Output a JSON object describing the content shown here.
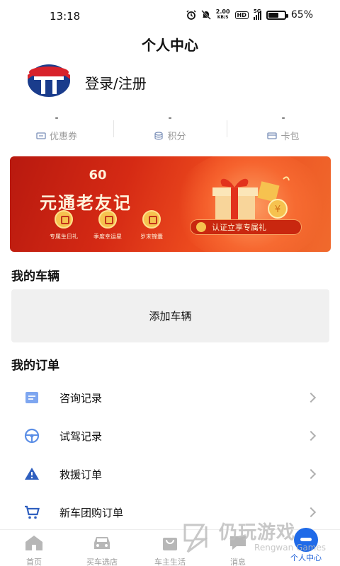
{
  "status_bar": {
    "time": "13:18",
    "net_speed_value": "2.00",
    "net_speed_unit": "KB/S",
    "hd": "HD",
    "signal_type": "5G",
    "battery_percent": "65%",
    "battery_level": 0.65
  },
  "header": {
    "title": "个人中心"
  },
  "profile": {
    "login_label": "登录/注册"
  },
  "stats": [
    {
      "value": "-",
      "label": "优惠券",
      "icon": "coupon-icon"
    },
    {
      "value": "-",
      "label": "积分",
      "icon": "points-icon"
    },
    {
      "value": "-",
      "label": "卡包",
      "icon": "card-wallet-icon"
    }
  ],
  "banner": {
    "logo_text": "60",
    "title": "元通老友记",
    "perks": [
      "专属生日礼",
      "季度幸运星",
      "岁末锦囊"
    ],
    "cta": "认证立享专属礼",
    "colors": {
      "start": "#b8190f",
      "end": "#f06a2d",
      "gold": "#f6c24f"
    }
  },
  "vehicles": {
    "title": "我的车辆",
    "add_label": "添加车辆"
  },
  "orders": {
    "title": "我的订单",
    "items": [
      {
        "label": "咨询记录",
        "icon": "consult-doc-icon"
      },
      {
        "label": "试驾记录",
        "icon": "steering-wheel-icon"
      },
      {
        "label": "救援订单",
        "icon": "warning-triangle-icon"
      },
      {
        "label": "新车团购订单",
        "icon": "shopping-cart-icon"
      }
    ]
  },
  "bottom_nav": [
    {
      "label": "首页",
      "icon": "home-icon",
      "active": false
    },
    {
      "label": "买车选店",
      "icon": "car-icon",
      "active": false
    },
    {
      "label": "车主生活",
      "icon": "bag-icon",
      "active": false
    },
    {
      "label": "消息",
      "icon": "message-icon",
      "active": false
    },
    {
      "label": "个人中心",
      "icon": "profile-icon",
      "active": true
    }
  ],
  "watermark": {
    "main": "仍玩游戏",
    "sub": "Rengwan Games"
  },
  "accent_color": "#1f6ae8"
}
